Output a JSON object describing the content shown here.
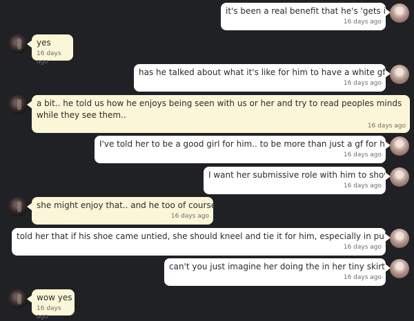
{
  "messages": [
    {
      "side": "out",
      "text": "it's been a real benefit that he's 'gets it'",
      "time": "16 days ago"
    },
    {
      "side": "in",
      "text": "yes",
      "time": "16 days ago"
    },
    {
      "side": "out",
      "text": "has he talked about what it's like for him to have a white gf..?",
      "time": "16 days ago"
    },
    {
      "side": "in",
      "text": "a bit.. he told us how he enjoys being seen with us or her and try to read peoples minds while they see them..",
      "time": "16 days ago"
    },
    {
      "side": "out",
      "text": "I've told her to be a good girl for him.. to be more than just a gf for him",
      "time": "16 days ago"
    },
    {
      "side": "out",
      "text": "I want her submissive role with him to show",
      "time": "16 days ago"
    },
    {
      "side": "in",
      "text": "she might enjoy that.. and he too of course",
      "time": "16 days ago"
    },
    {
      "side": "out",
      "text": "told her that if his shoe came untied, she should kneel and tie it for him, especially in public",
      "time": "16 days ago"
    },
    {
      "side": "out",
      "text": "can't you just imagine her doing the in her tiny skirt..?",
      "time": "16 days ago"
    },
    {
      "side": "in",
      "text": "wow yes",
      "time": "16 days ago"
    }
  ]
}
